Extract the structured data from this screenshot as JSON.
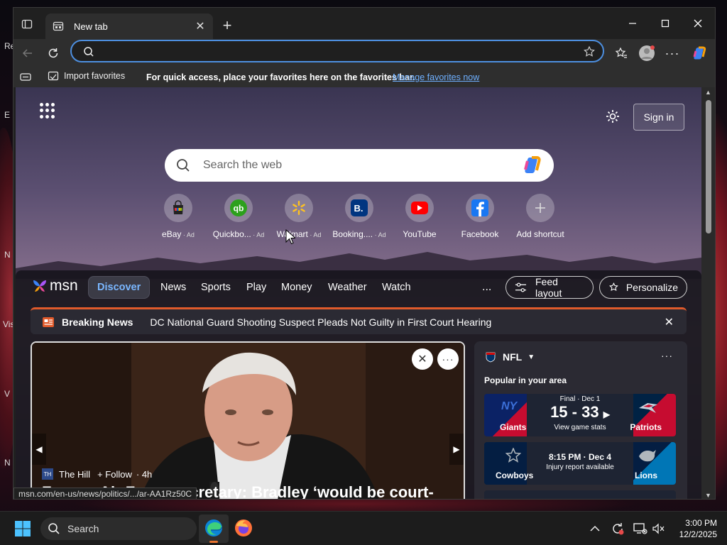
{
  "desktop": {
    "labels": [
      "Re",
      "E",
      "N",
      "Vis",
      "V",
      "N"
    ]
  },
  "browser": {
    "tab_title": "New tab",
    "address_value": "",
    "favorites_bar": {
      "import_label": "Import favorites",
      "prompt": "For quick access, place your favorites here on the favorites bar.",
      "manage_link": "Manage favorites now"
    },
    "status_url": "msn.com/en-us/news/politics/.../ar-AA1Rz50C"
  },
  "ntp": {
    "sign_in": "Sign in",
    "search_placeholder": "Search the web",
    "shortcuts": [
      {
        "label": "eBay",
        "ad": "Ad",
        "icon": "ebay-icon"
      },
      {
        "label": "Quickbo...",
        "ad": "Ad",
        "icon": "quickbooks-icon"
      },
      {
        "label": "Walmart",
        "ad": "Ad",
        "icon": "walmart-icon"
      },
      {
        "label": "Booking....",
        "ad": "Ad",
        "icon": "booking-icon"
      },
      {
        "label": "YouTube",
        "ad": "",
        "icon": "youtube-icon"
      },
      {
        "label": "Facebook",
        "ad": "",
        "icon": "facebook-icon"
      },
      {
        "label": "Add shortcut",
        "ad": "",
        "icon": "plus-icon"
      }
    ],
    "msn_logo": "msn",
    "nav": [
      "Discover",
      "News",
      "Sports",
      "Play",
      "Money",
      "Weather",
      "Watch"
    ],
    "more": "...",
    "feed_layout": "Feed layout",
    "personalize": "Personalize",
    "breaking": {
      "label": "Breaking News",
      "headline": "DC National Guard Shooting Suspect Pleads Not Guilty in First Court Hearing"
    },
    "story": {
      "source": "The Hill",
      "follow": "Follow",
      "age": "· 4h",
      "headline": "Former Air Force secretary: Bradley ‘would be court-"
    },
    "nfl": {
      "title": "NFL",
      "popular": "Popular in your area",
      "games": [
        {
          "status": "Final · Dec 1",
          "score": "15 - 33",
          "sub": "View game stats",
          "home": "Giants",
          "away": "Patriots",
          "home_abbr": "NY",
          "home_color": "#0b2265",
          "away_color": "#c60c30"
        },
        {
          "status": "8:15 PM · Dec 4",
          "score": "",
          "sub": "Injury report available",
          "home": "Cowboys",
          "away": "Lions",
          "home_abbr": "★",
          "home_color": "#041e42",
          "away_color": "#0076b6"
        }
      ]
    }
  },
  "taskbar": {
    "search": "Search",
    "time": "3:00 PM",
    "date": "12/2/2025"
  },
  "colors": {
    "accent": "#4d8fe0",
    "breaking": "#e05a2b"
  }
}
